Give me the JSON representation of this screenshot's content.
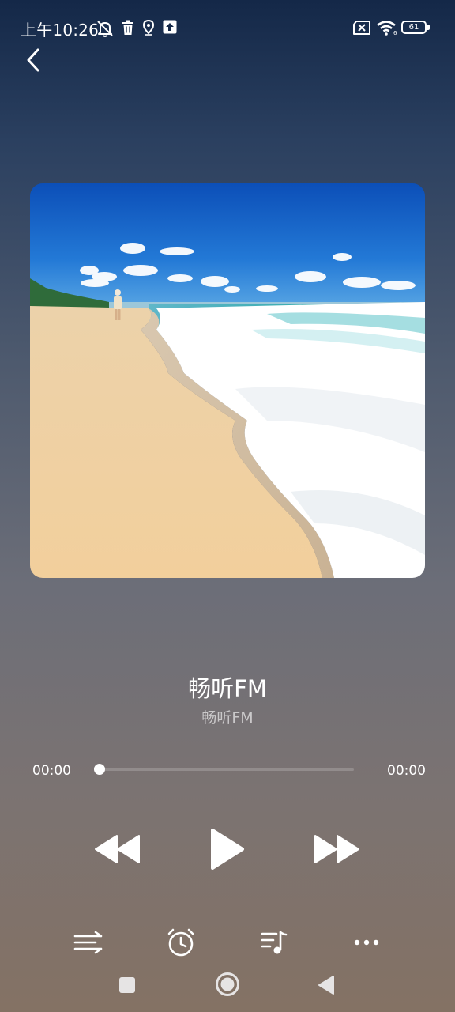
{
  "status_bar": {
    "time": "上午10:26",
    "battery_level": "61",
    "icons": [
      "notifications-off-icon",
      "trash-icon",
      "location-icon",
      "upload-icon",
      "no-sim-icon",
      "wifi-icon",
      "battery-icon"
    ]
  },
  "navigation": {
    "back_icon": "chevron-left-icon"
  },
  "album_art": {
    "description_icon": "beach-cover-image"
  },
  "track": {
    "title": "畅听FM",
    "artist": "畅听FM"
  },
  "progress": {
    "elapsed": "00:00",
    "total": "00:00",
    "fraction": 0
  },
  "controls": {
    "previous_icon": "rewind-icon",
    "play_icon": "play-icon",
    "next_icon": "fast-forward-icon"
  },
  "bottom_actions": [
    "shuffle-icon",
    "alarm-timer-icon",
    "playlist-icon",
    "more-icon"
  ],
  "system_nav": [
    "recents-square-icon",
    "home-circle-icon",
    "back-triangle-icon"
  ],
  "colors": {
    "gradient_top": "#142848",
    "gradient_bottom": "#847264",
    "text_primary": "#ffffff",
    "text_secondary": "#c9c6c6"
  }
}
